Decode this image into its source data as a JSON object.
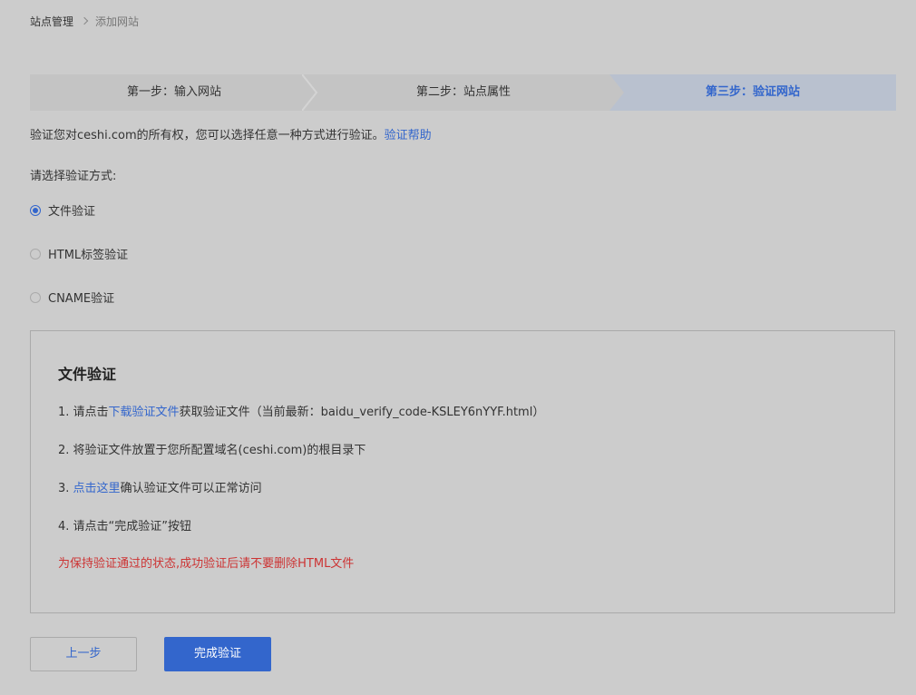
{
  "breadcrumb": {
    "root": "站点管理",
    "current": "添加网站"
  },
  "steps": [
    {
      "label": "第一步：输入网站",
      "active": false
    },
    {
      "label": "第二步：站点属性",
      "active": false
    },
    {
      "label": "第三步：验证网站",
      "active": true
    }
  ],
  "intro": {
    "text": "验证您对ceshi.com的所有权，您可以选择任意一种方式进行验证。",
    "help_link": "验证帮助"
  },
  "choose_label": "请选择验证方式:",
  "methods": [
    {
      "label": "文件验证",
      "checked": true
    },
    {
      "label": "HTML标签验证",
      "checked": false
    },
    {
      "label": "CNAME验证",
      "checked": false
    }
  ],
  "box": {
    "title": "文件验证",
    "step1_prefix": "1.  请点击",
    "step1_link": "下载验证文件",
    "step1_suffix": "获取验证文件（当前最新：baidu_verify_code-KSLEY6nYYF.html）",
    "step2": "2.  将验证文件放置于您所配置域名(ceshi.com)的根目录下",
    "step3_prefix": "3.  ",
    "step3_link": "点击这里",
    "step3_suffix": "确认验证文件可以正常访问",
    "step4": "4.  请点击“完成验证”按钮",
    "warning": "为保持验证通过的状态,成功验证后请不要删除HTML文件"
  },
  "buttons": {
    "prev": "上一步",
    "done": "完成验证"
  },
  "colors": {
    "background": "#cccccc",
    "accent": "#3366cc",
    "warning": "#cc3333",
    "active_step_bg": "#b9c1cf"
  }
}
